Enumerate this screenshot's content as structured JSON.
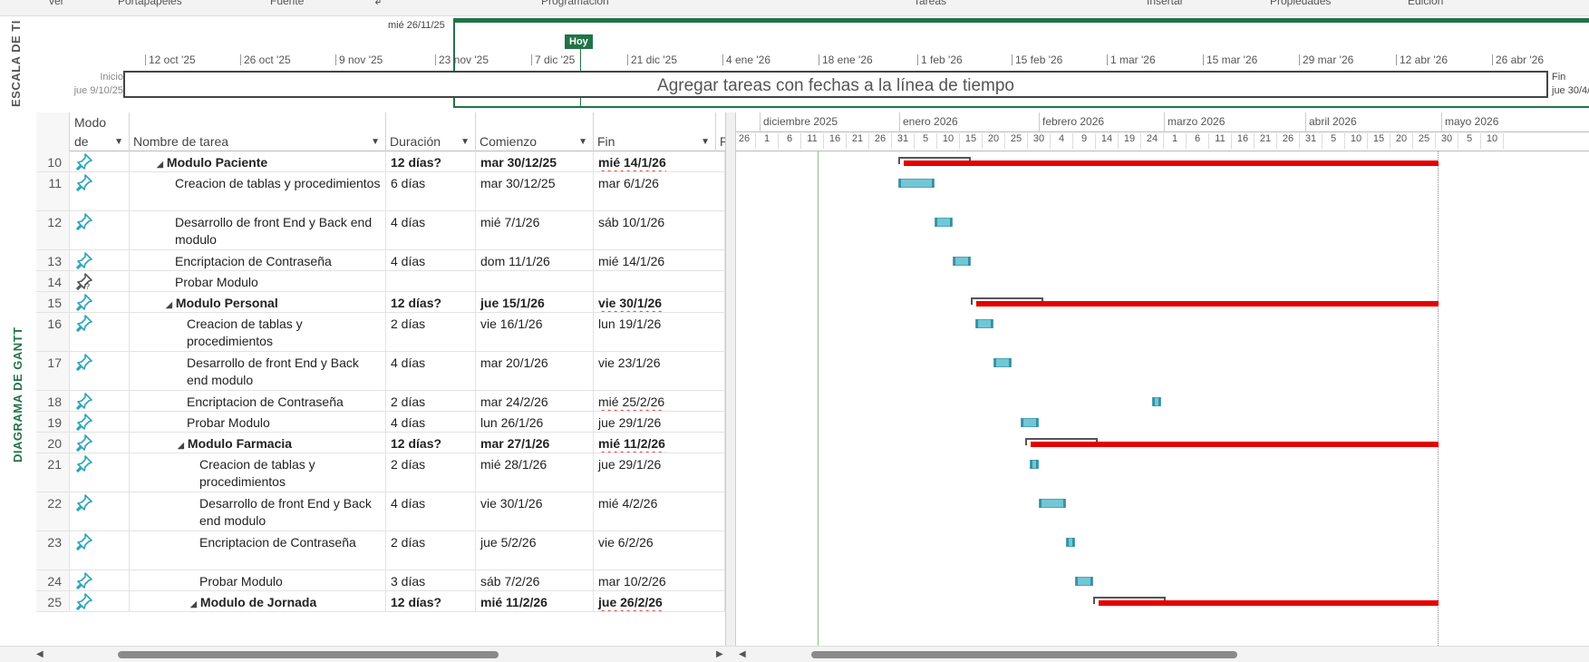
{
  "ribbon": {
    "groups": [
      "ver",
      "Portapapeles",
      "Fuente",
      "↲",
      "Programación",
      "Tareas",
      "Insertar",
      "Propiedades",
      "Edición"
    ]
  },
  "side_labels": {
    "timeline": "ESCALA DE TI",
    "gantt": "DIAGRAMA DE GANTT"
  },
  "timeline": {
    "window_start_date": "mié 26/11/25",
    "today_label": "Hoy",
    "ticks": [
      "12 oct '25",
      "26 oct '25",
      "9 nov '25",
      "23 nov '25",
      "7 dic '25",
      "21 dic '25",
      "4 ene '26",
      "18 ene '26",
      "1 feb '26",
      "15 feb '26",
      "1 mar '26",
      "15 mar '26",
      "29 mar '26",
      "12 abr '26",
      "26 abr '26"
    ],
    "start_label": "Inicio",
    "start_date": "jue 9/10/25",
    "end_label": "Fin",
    "end_date": "jue 30/4/",
    "placeholder": "Agregar tareas con fechas a la línea de tiempo"
  },
  "grid": {
    "headers": {
      "mode_line1": "Modo",
      "mode_line2": "de",
      "name": "Nombre de tarea",
      "duration": "Duración",
      "start": "Comienzo",
      "end": "Fin",
      "pred": "P"
    },
    "rows": [
      {
        "id": "10",
        "mode": "pin-icon",
        "name": "Modulo Paciente",
        "duration": "12 días?",
        "start": "mar 30/12/25",
        "end": "mié 14/1/26"
      },
      {
        "id": "11",
        "mode": "pin-icon",
        "name": "Creacion de  tablas  y procedimientos",
        "duration": "6 días",
        "start": "mar 30/12/25",
        "end": "mar 6/1/26"
      },
      {
        "id": "12",
        "mode": "pin-icon",
        "name": "Desarrollo de front End y Back end modulo",
        "duration": "4 días",
        "start": "mié 7/1/26",
        "end": "sáb 10/1/26"
      },
      {
        "id": "13",
        "mode": "pin-icon",
        "name": "Encriptacion de Contraseña",
        "duration": "4 días",
        "start": "dom 11/1/26",
        "end": "mié 14/1/26"
      },
      {
        "id": "14",
        "mode": "pin-question-icon",
        "name": "Probar Modulo",
        "duration": "",
        "start": "",
        "end": ""
      },
      {
        "id": "15",
        "mode": "pin-icon",
        "name": "Modulo Personal",
        "duration": "12 días?",
        "start": "jue 15/1/26",
        "end": "vie 30/1/26"
      },
      {
        "id": "16",
        "mode": "pin-icon",
        "name": "Creacion de  tablas  y procedimientos",
        "duration": "2 días",
        "start": "vie 16/1/26",
        "end": "lun 19/1/26"
      },
      {
        "id": "17",
        "mode": "pin-icon",
        "name": "Desarrollo de front End y Back end modulo",
        "duration": "4 días",
        "start": "mar 20/1/26",
        "end": "vie 23/1/26"
      },
      {
        "id": "18",
        "mode": "pin-icon",
        "name": "Encriptacion de Contraseña",
        "duration": "2 días",
        "start": "mar 24/2/26",
        "end": "mié 25/2/26"
      },
      {
        "id": "19",
        "mode": "pin-icon",
        "name": "Probar Modulo",
        "duration": "4 días",
        "start": "lun 26/1/26",
        "end": "jue 29/1/26"
      },
      {
        "id": "20",
        "mode": "pin-icon",
        "name": "Modulo Farmacia",
        "duration": "12 días?",
        "start": "mar 27/1/26",
        "end": "mié 11/2/26"
      },
      {
        "id": "21",
        "mode": "pin-icon",
        "name": "Creacion de  tablas  y procedimientos",
        "duration": "2 días",
        "start": "mié 28/1/26",
        "end": "jue 29/1/26"
      },
      {
        "id": "22",
        "mode": "pin-icon",
        "name": "Desarrollo de front End y Back end modulo",
        "duration": "4 días",
        "start": "vie 30/1/26",
        "end": "mié 4/2/26"
      },
      {
        "id": "23",
        "mode": "pin-icon",
        "name": "Encriptacion de Contraseña",
        "duration": "2 días",
        "start": "jue 5/2/26",
        "end": "vie 6/2/26"
      },
      {
        "id": "24",
        "mode": "pin-icon",
        "name": "Probar Modulo",
        "duration": "3 días",
        "start": "sáb 7/2/26",
        "end": "mar 10/2/26"
      },
      {
        "id": "25",
        "mode": "pin-icon",
        "name": "Modulo de Jornada",
        "duration": "12 días?",
        "start": "mié 11/2/26",
        "end": "jue 26/2/26"
      }
    ]
  },
  "chart": {
    "months": [
      "diciembre 2025",
      "enero 2026",
      "febrero 2026",
      "marzo 2026",
      "abril 2026",
      "mayo 2026"
    ],
    "days": [
      "26",
      "1",
      "6",
      "11",
      "16",
      "21",
      "26",
      "31",
      "5",
      "10",
      "15",
      "20",
      "25",
      "30",
      "4",
      "9",
      "14",
      "19",
      "24",
      "1",
      "6",
      "11",
      "16",
      "21",
      "26",
      "31",
      "5",
      "10",
      "15",
      "20",
      "25",
      "30",
      "5",
      "10"
    ]
  },
  "colors": {
    "accent_green": "#217346",
    "task_bar": "#72c7d6",
    "late_bar": "#e60000"
  }
}
